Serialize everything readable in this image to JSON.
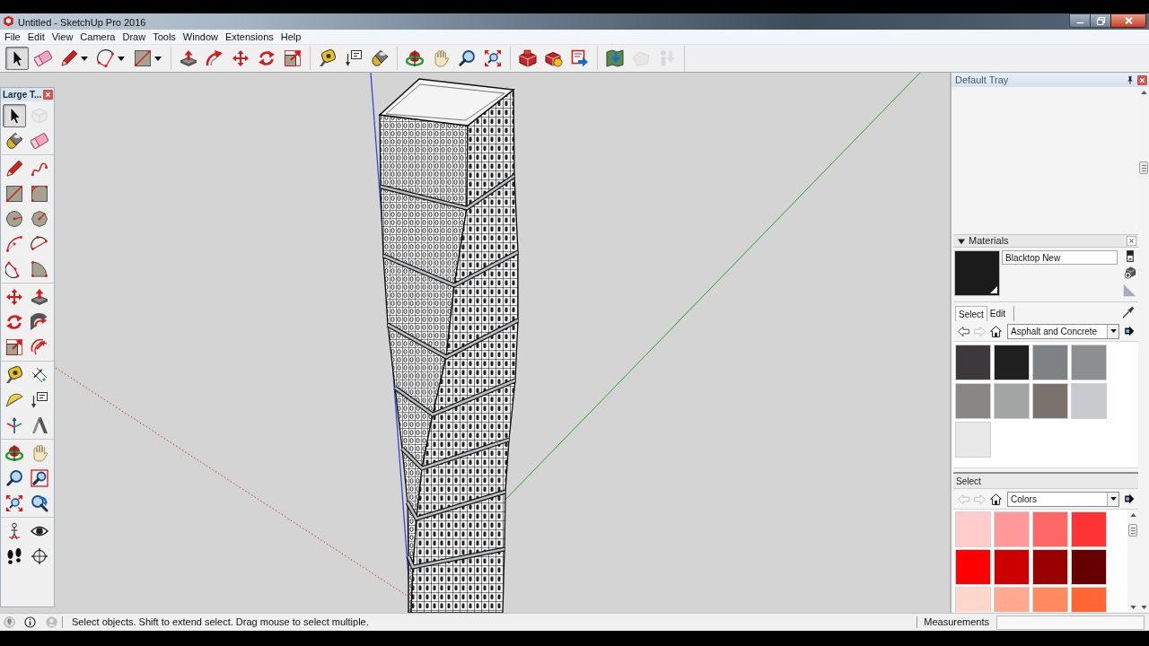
{
  "window": {
    "title": "Untitled - SketchUp Pro 2016"
  },
  "menu": [
    "File",
    "Edit",
    "View",
    "Camera",
    "Draw",
    "Tools",
    "Window",
    "Extensions",
    "Help"
  ],
  "toolbar": {
    "tools": [
      {
        "selected": true,
        "disabled": false
      },
      {
        "selected": false,
        "disabled": false
      },
      {
        "selected": false,
        "disabled": false
      },
      {
        "selected": false,
        "disabled": false
      },
      {
        "selected": false,
        "disabled": false
      },
      {
        "selected": false,
        "disabled": false
      },
      {
        "selected": false,
        "disabled": false
      },
      {
        "selected": false,
        "disabled": false
      },
      {
        "selected": false,
        "disabled": false
      },
      {
        "selected": false,
        "disabled": false
      },
      {
        "selected": false,
        "disabled": false
      },
      {
        "selected": false,
        "disabled": false
      },
      {
        "selected": false,
        "disabled": false
      },
      {
        "selected": false,
        "disabled": false
      },
      {
        "selected": false,
        "disabled": false
      },
      {
        "selected": false,
        "disabled": false
      },
      {
        "selected": false,
        "disabled": false
      },
      {
        "selected": false,
        "disabled": false
      },
      {
        "selected": false,
        "disabled": false
      },
      {
        "selected": false,
        "disabled": false
      },
      {
        "selected": false,
        "disabled": false
      },
      {
        "selected": false,
        "disabled": true
      },
      {
        "selected": false,
        "disabled": true
      }
    ]
  },
  "tool_palette": {
    "title": "Large T...",
    "tools": [
      {
        "selected": true,
        "disabled": false
      },
      {
        "selected": false,
        "disabled": true
      },
      {
        "selected": false,
        "disabled": false
      },
      {
        "selected": false,
        "disabled": false
      },
      {
        "selected": false,
        "disabled": false
      },
      {
        "selected": false,
        "disabled": false
      },
      {
        "selected": false,
        "disabled": false
      },
      {
        "selected": false,
        "disabled": false
      },
      {
        "selected": false,
        "disabled": false
      },
      {
        "selected": false,
        "disabled": false
      },
      {
        "selected": false,
        "disabled": false
      },
      {
        "selected": false,
        "disabled": false
      },
      {
        "selected": false,
        "disabled": false
      },
      {
        "selected": false,
        "disabled": false
      },
      {
        "selected": false,
        "disabled": false
      },
      {
        "selected": false,
        "disabled": false
      },
      {
        "selected": false,
        "disabled": false
      },
      {
        "selected": false,
        "disabled": false
      },
      {
        "selected": false,
        "disabled": false
      },
      {
        "selected": false,
        "disabled": false
      },
      {
        "selected": false,
        "disabled": false
      },
      {
        "selected": false,
        "disabled": false
      },
      {
        "selected": false,
        "disabled": false
      },
      {
        "selected": false,
        "disabled": false
      },
      {
        "selected": false,
        "disabled": false
      },
      {
        "selected": false,
        "disabled": false
      },
      {
        "selected": false,
        "disabled": false
      },
      {
        "selected": false,
        "disabled": false
      },
      {
        "selected": false,
        "disabled": false
      },
      {
        "selected": false,
        "disabled": false
      },
      {
        "selected": false,
        "disabled": false
      },
      {
        "selected": false,
        "disabled": false
      },
      {
        "selected": false,
        "disabled": false
      },
      {
        "selected": false,
        "disabled": false
      },
      {
        "selected": false,
        "disabled": false
      },
      {
        "selected": false,
        "disabled": false
      }
    ]
  },
  "tray": {
    "title": "Default Tray",
    "materials": {
      "title": "Materials",
      "expanded": true,
      "material_name": "Blacktop New",
      "tabs": [
        {
          "label": "Select",
          "selected": true
        },
        {
          "label": "Edit",
          "selected": false
        }
      ],
      "nav": {
        "back_disabled": false,
        "forward_disabled": true
      },
      "library": "Asphalt and Concrete",
      "swatches": [
        {
          "color": "#3d383b"
        },
        {
          "color": "#1f1f1f"
        },
        {
          "color": "#7e8285"
        },
        {
          "color": "#8d8e8f"
        },
        {
          "color": "#8a8686"
        },
        {
          "color": "#a2a5a3"
        },
        {
          "color": "#7a736d"
        },
        {
          "color": "#c9cacd"
        },
        {
          "color": "#e8e8e8"
        }
      ]
    },
    "secondary": {
      "title": "Select",
      "nav": {
        "back_disabled": true,
        "forward_disabled": true
      },
      "library": "Colors",
      "swatches": [
        {
          "color": "#ffcccc"
        },
        {
          "color": "#ff9999"
        },
        {
          "color": "#ff6666"
        },
        {
          "color": "#ff3333"
        },
        {
          "color": "#ff0000"
        },
        {
          "color": "#cc0000"
        },
        {
          "color": "#990000"
        },
        {
          "color": "#660000"
        },
        {
          "color": "#ffd6cc"
        },
        {
          "color": "#ffaa90"
        },
        {
          "color": "#ff8a60"
        },
        {
          "color": "#ff6633"
        }
      ]
    }
  },
  "status_bar": {
    "hint": "Select objects. Shift to extend select. Drag mouse to select multiple.",
    "measurements_label": "Measurements"
  }
}
